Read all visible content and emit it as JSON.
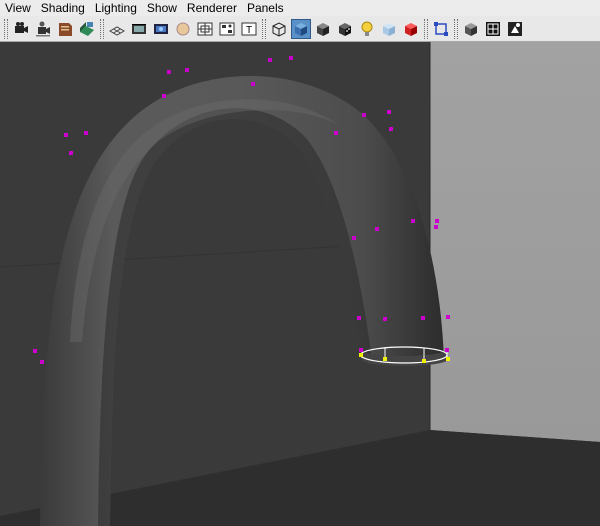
{
  "menubar": {
    "items": [
      {
        "id": "view",
        "label": "View"
      },
      {
        "id": "shading",
        "label": "Shading"
      },
      {
        "id": "lighting",
        "label": "Lighting"
      },
      {
        "id": "show",
        "label": "Show"
      },
      {
        "id": "renderer",
        "label": "Renderer"
      },
      {
        "id": "panels",
        "label": "Panels"
      }
    ]
  },
  "toolbar": {
    "groups": [
      [
        {
          "icon": "select-camera-icon"
        },
        {
          "icon": "camera-attributes-icon"
        },
        {
          "icon": "bookmark-icon"
        },
        {
          "icon": "image-plane-icon"
        }
      ],
      [
        {
          "icon": "grid-icon"
        },
        {
          "icon": "film-gate-icon"
        },
        {
          "icon": "resolution-gate-icon"
        },
        {
          "icon": "gate-mask-icon"
        },
        {
          "icon": "field-chart-icon"
        },
        {
          "icon": "safe-action-icon"
        },
        {
          "icon": "safe-title-icon"
        }
      ],
      [
        {
          "icon": "wireframe-icon"
        },
        {
          "icon": "smooth-shade-icon",
          "active": true
        },
        {
          "icon": "wireframe-on-shaded-icon"
        },
        {
          "icon": "textured-icon"
        },
        {
          "icon": "use-all-lights-icon"
        },
        {
          "icon": "xray-icon"
        },
        {
          "icon": "xray-active-components-icon"
        }
      ],
      [
        {
          "icon": "isolate-select-icon"
        }
      ],
      [
        {
          "icon": "xray-joints-icon"
        },
        {
          "icon": "two-sided-lighting-icon"
        },
        {
          "icon": "high-quality-icon"
        }
      ]
    ]
  },
  "viewport": {
    "background_color": "#3a3a3a",
    "wall_color": "#a0a0a0",
    "floor_color": "#2e2e2e",
    "mesh_color": "#545454",
    "vertex_color": "#cc00cc",
    "selected_vertex_color": "#f0f000"
  }
}
